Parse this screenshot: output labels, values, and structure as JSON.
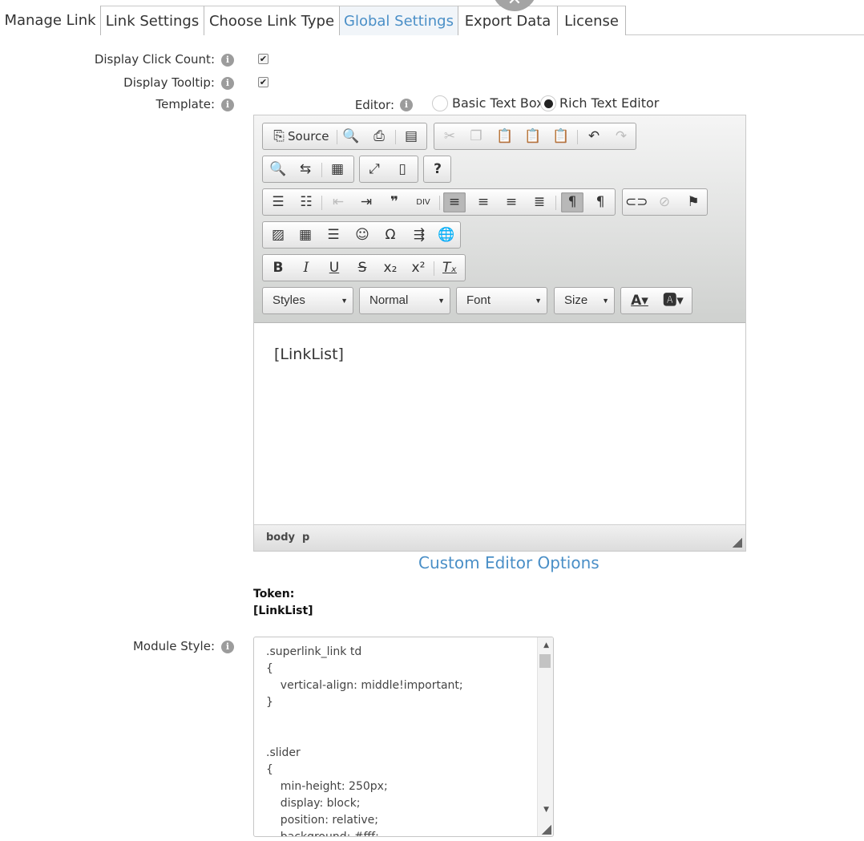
{
  "tabs": [
    {
      "label": "Manage Link"
    },
    {
      "label": "Link Settings"
    },
    {
      "label": "Choose Link Type"
    },
    {
      "label": "Global Settings",
      "active": true
    },
    {
      "label": "Export Data"
    },
    {
      "label": "License"
    }
  ],
  "overlay": {
    "close_glyph": "✕"
  },
  "form": {
    "display_click_count": {
      "label": "Display Click Count:",
      "checked": true
    },
    "display_tooltip": {
      "label": "Display Tooltip:",
      "checked": true
    },
    "template": {
      "label": "Template:"
    },
    "editor": {
      "label": "Editor:",
      "options": [
        {
          "label": "Basic Text Box",
          "selected": false
        },
        {
          "label": "Rich Text Editor",
          "selected": true
        }
      ]
    },
    "module_style": {
      "label": "Module Style:"
    }
  },
  "icons": {
    "info": "i",
    "check": "✔"
  },
  "rte": {
    "source_label": "Source",
    "combos": {
      "styles": "Styles",
      "format": "Normal",
      "font": "Font",
      "size": "Size"
    },
    "content": "[LinkList]",
    "path": [
      "body",
      "p"
    ]
  },
  "custom_editor_options": "Custom Editor Options",
  "token": {
    "label": "Token:",
    "value": "[LinkList]"
  },
  "module_style_code": ".superlink_link td\n{\n    vertical-align: middle!important;\n}\n\n\n.slider\n{\n    min-height: 250px;\n    display: block;\n    position: relative;\n    background: #fff;"
}
